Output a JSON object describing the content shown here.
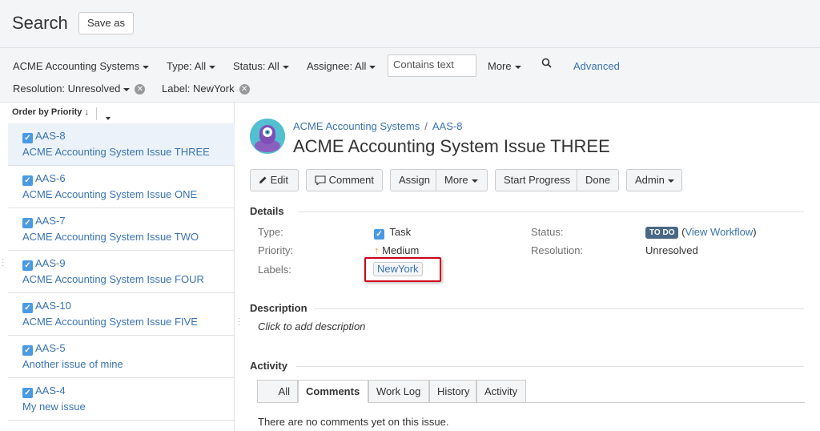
{
  "header": {
    "title": "Search",
    "save_as_label": "Save as"
  },
  "filters": {
    "project": "ACME Accounting Systems",
    "type": "Type: All",
    "status": "Status: All",
    "assignee": "Assignee: All",
    "contains_placeholder": "Contains text",
    "more": "More",
    "advanced": "Advanced",
    "resolution": "Resolution: Unresolved",
    "label": "Label: NewYork"
  },
  "sidebar": {
    "order_label": "Order by Priority",
    "items": [
      {
        "key": "AAS-8",
        "summary": "ACME Accounting System Issue THREE"
      },
      {
        "key": "AAS-6",
        "summary": "ACME Accounting System Issue ONE"
      },
      {
        "key": "AAS-7",
        "summary": "ACME Accounting System Issue TWO"
      },
      {
        "key": "AAS-9",
        "summary": "ACME Accounting System Issue FOUR"
      },
      {
        "key": "AAS-10",
        "summary": "ACME Accounting System Issue FIVE"
      },
      {
        "key": "AAS-5",
        "summary": "Another issue of mine"
      },
      {
        "key": "AAS-4",
        "summary": "My new issue"
      }
    ]
  },
  "issue": {
    "project": "ACME Accounting Systems",
    "crumb_sep": "/",
    "key": "AAS-8",
    "title": "ACME Accounting System Issue THREE"
  },
  "toolbar": {
    "edit": "Edit",
    "comment": "Comment",
    "assign": "Assign",
    "more": "More",
    "start_progress": "Start Progress",
    "done": "Done",
    "admin": "Admin"
  },
  "details": {
    "heading": "Details",
    "type_label": "Type:",
    "type_value": "Task",
    "priority_label": "Priority:",
    "priority_value": "Medium",
    "labels_label": "Labels:",
    "labels_value": "NewYork",
    "status_label": "Status:",
    "status_value": "TO DO",
    "status_open_paren": "(",
    "view_workflow": "View Workflow",
    "status_close_paren": ")",
    "resolution_label": "Resolution:",
    "resolution_value": "Unresolved"
  },
  "description": {
    "heading": "Description",
    "placeholder": "Click to add description"
  },
  "activity": {
    "heading": "Activity",
    "tabs": [
      "All",
      "Comments",
      "Work Log",
      "History",
      "Activity"
    ],
    "active_tab": "Comments",
    "message": "There are no comments yet on this issue."
  },
  "colors": {
    "link": "#3b73af",
    "lozenge": "#4a6785",
    "highlight": "#d0021b",
    "selected_row": "#ebf2f9"
  }
}
